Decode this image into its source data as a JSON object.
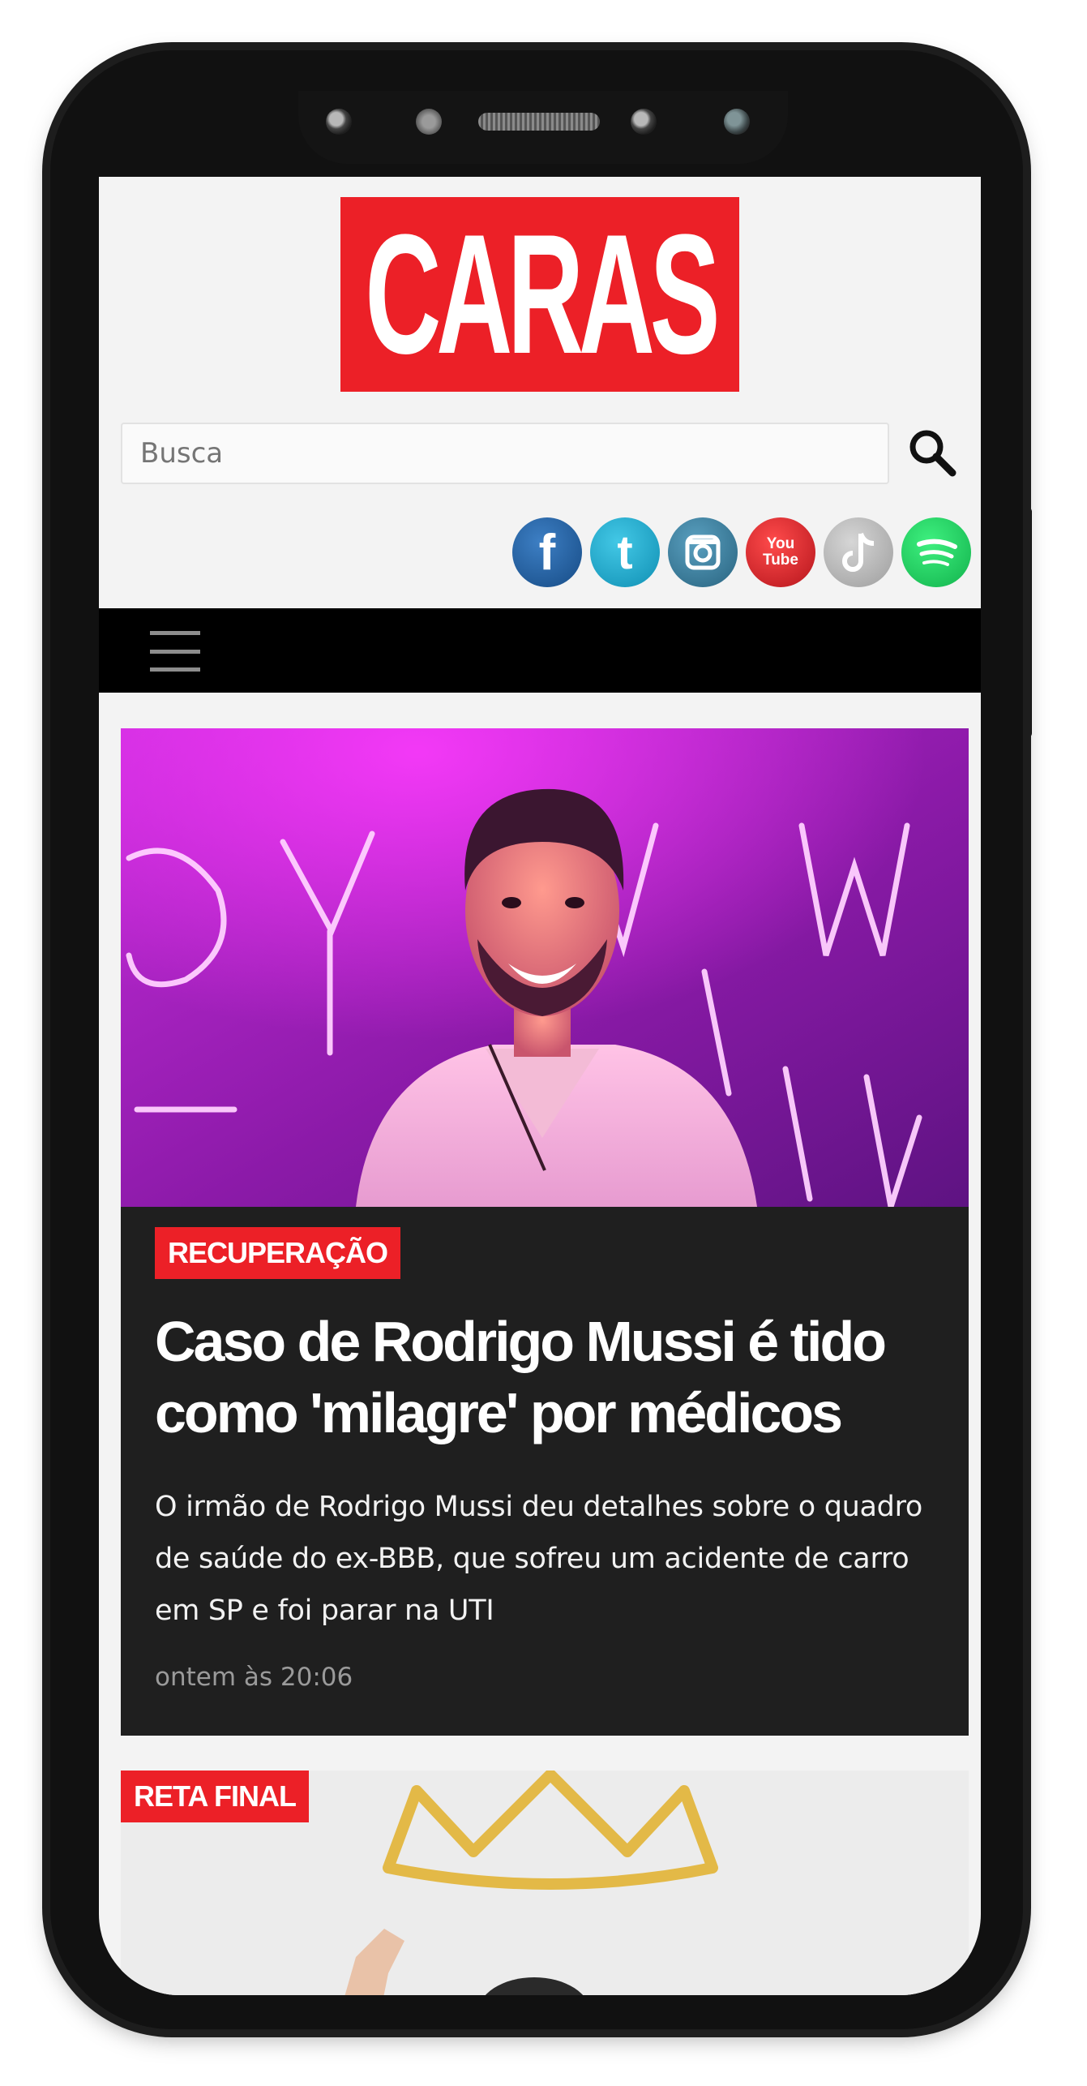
{
  "brand": {
    "logo_text": "CARAS",
    "accent_color": "#ec2027"
  },
  "search": {
    "placeholder": "Busca",
    "icon": "search-icon"
  },
  "social": [
    {
      "name": "facebook",
      "glyph": "f",
      "color": "#1d5a9c"
    },
    {
      "name": "twitter",
      "glyph": "t",
      "color": "#18a8cc"
    },
    {
      "name": "instagram",
      "glyph": "",
      "color": "#3a7fa0"
    },
    {
      "name": "youtube",
      "glyph": "You Tube",
      "color": "#d7202a"
    },
    {
      "name": "tiktok",
      "glyph": "",
      "color": "#b9b9b9"
    },
    {
      "name": "spotify",
      "glyph": "",
      "color": "#1ed760"
    }
  ],
  "nav": {
    "menu_icon": "hamburger-menu-icon"
  },
  "featured": {
    "tag": "RECUPERAÇÃO",
    "title": "Caso de Rodrigo Mussi é tido como 'milagre' por médicos",
    "description": "O irmão de Rodrigo Mussi deu detalhes sobre o quadro de saúde do ex-BBB, que sofreu um acidente de carro em SP e foi parar na UTI",
    "date": "ontem às 20:06"
  },
  "second": {
    "tag": "RETA FINAL"
  }
}
